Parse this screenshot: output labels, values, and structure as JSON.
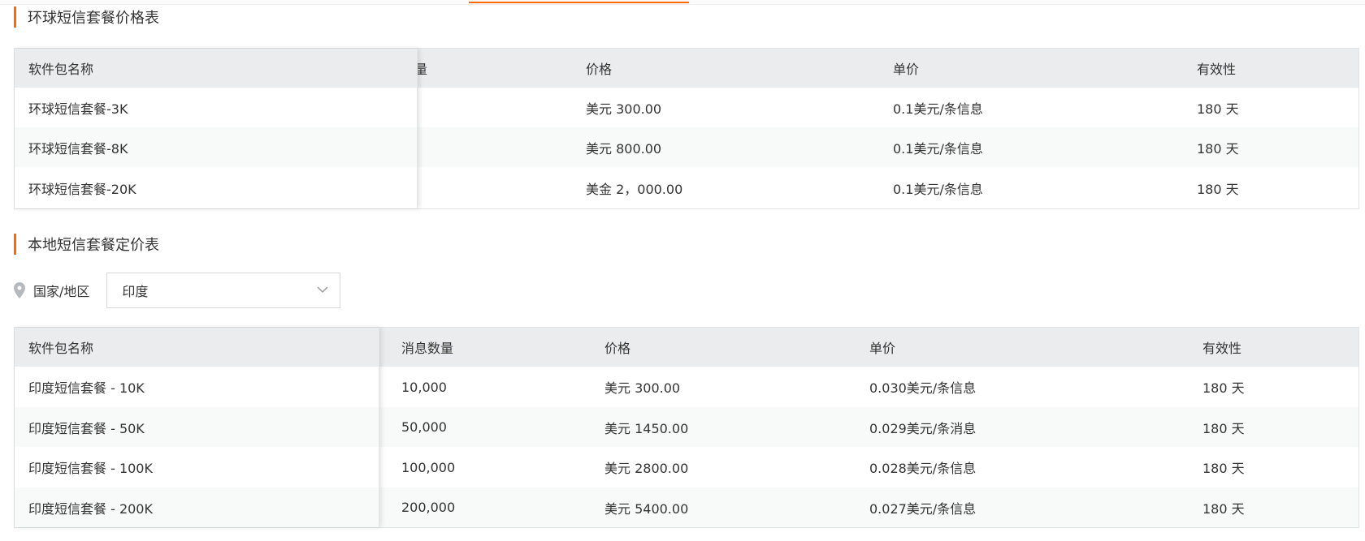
{
  "global_section": {
    "title": "环球短信套餐价格表",
    "columns": [
      "软件包名称",
      "量",
      "价格",
      "单价",
      "有效性"
    ],
    "rows": [
      {
        "name": "环球短信套餐-3K",
        "price": "美元 300.00",
        "unit": "0.1美元/条信息",
        "validity": "180 天"
      },
      {
        "name": "环球短信套餐-8K",
        "price": "美元 800.00",
        "unit": "0.1美元/条信息",
        "validity": "180 天"
      },
      {
        "name": "环球短信套餐-20K",
        "price": "美金 2，000.00",
        "unit": "0.1美元/条信息",
        "validity": "180 天"
      }
    ]
  },
  "local_section": {
    "title": "本地短信套餐定价表",
    "filter": {
      "label": "国家/地区",
      "icon": "location-pin-icon",
      "selected": "印度"
    },
    "columns": [
      "软件包名称",
      "消息数量",
      "价格",
      "单价",
      "有效性"
    ],
    "rows": [
      {
        "name": "印度短信套餐 - 10K",
        "qty": "10,000",
        "price": "美元 300.00",
        "unit": "0.030美元/条信息",
        "validity": "180 天"
      },
      {
        "name": "印度短信套餐 - 50K",
        "qty": "50,000",
        "price": "美元 1450.00",
        "unit": "0.029美元/条消息",
        "validity": "180 天"
      },
      {
        "name": "印度短信套餐 - 100K",
        "qty": "100,000",
        "price": "美元 2800.00",
        "unit": "0.028美元/条信息",
        "validity": "180 天"
      },
      {
        "name": "印度短信套餐 - 200K",
        "qty": "200,000",
        "price": "美元 5400.00",
        "unit": "0.027美元/条信息",
        "validity": "180 天"
      }
    ]
  },
  "colors": {
    "accent": "#ff6a00",
    "header_bg": "#ebeced",
    "stripe_bg": "#f8f9f9",
    "border": "#e1e3e3"
  }
}
